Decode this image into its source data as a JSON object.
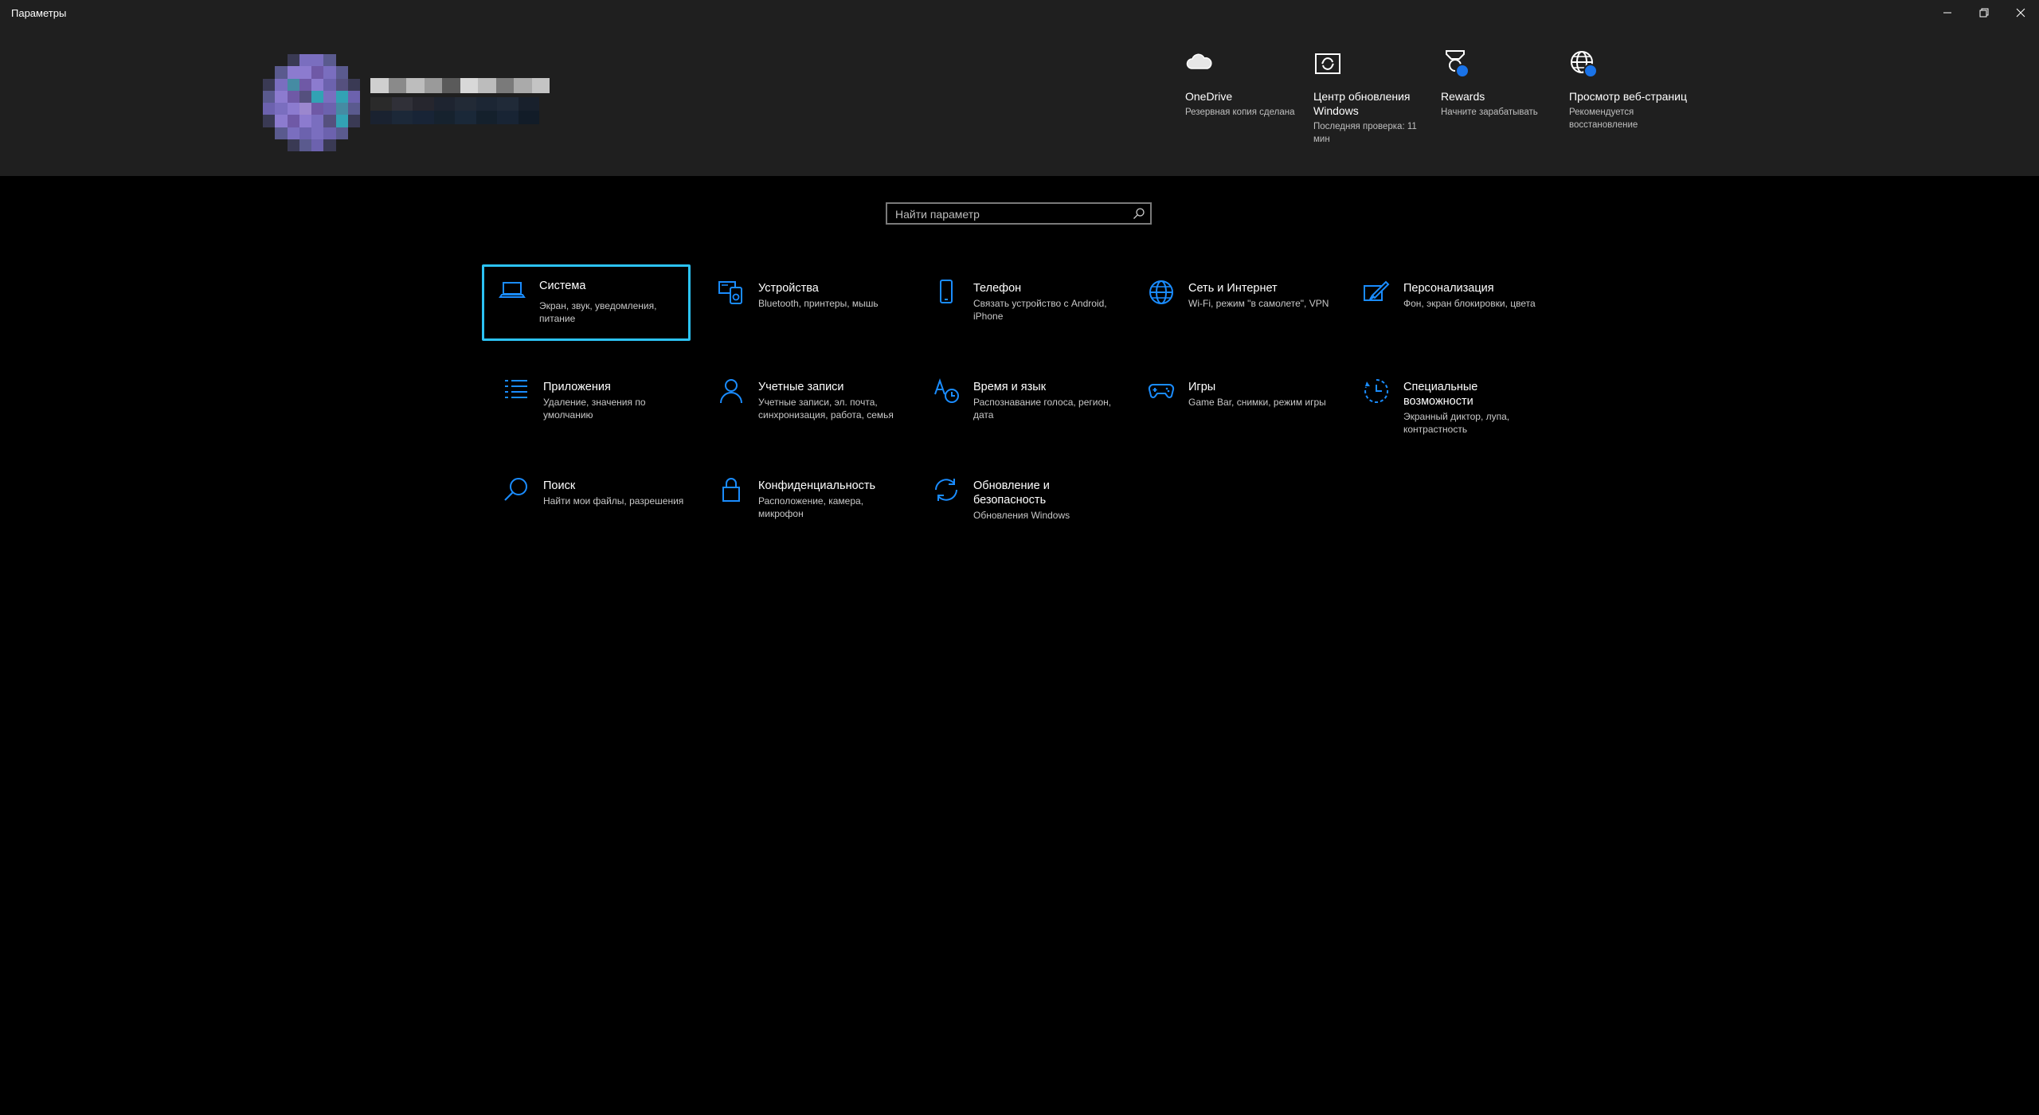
{
  "window": {
    "title": "Параметры",
    "controls": {
      "minimize": "–",
      "maximize": "❐",
      "close": "✕"
    }
  },
  "account": {
    "name_redacted": true
  },
  "quick_links": [
    {
      "title": "OneDrive",
      "subtitle": "Резервная копия сделана",
      "icon": "cloud-icon"
    },
    {
      "title": "Центр обновления Windows",
      "subtitle": "Последняя проверка: 11 мин",
      "icon": "sync-icon"
    },
    {
      "title": "Rewards",
      "subtitle": "Начните зарабатывать",
      "icon": "trophy-icon"
    },
    {
      "title": "Просмотр веб-страниц",
      "subtitle": "Рекомендуется восстановление",
      "icon": "globe-icon"
    }
  ],
  "search": {
    "placeholder": "Найти параметр",
    "value": ""
  },
  "categories": [
    {
      "title": "Система",
      "description": "Экран, звук, уведомления, питание",
      "icon": "laptop-icon"
    },
    {
      "title": "Устройства",
      "description": "Bluetooth, принтеры, мышь",
      "icon": "devices-icon"
    },
    {
      "title": "Телефон",
      "description": "Связать устройство с Android, iPhone",
      "icon": "phone-icon"
    },
    {
      "title": "Сеть и Интернет",
      "description": "Wi-Fi, режим \"в самолете\", VPN",
      "icon": "globe-icon"
    },
    {
      "title": "Персонализация",
      "description": "Фон, экран блокировки, цвета",
      "icon": "brush-icon"
    },
    {
      "title": "Приложения",
      "description": "Удаление, значения по умолчанию",
      "icon": "apps-list-icon"
    },
    {
      "title": "Учетные записи",
      "description": "Учетные записи, эл. почта, синхронизация, работа, семья",
      "icon": "person-icon"
    },
    {
      "title": "Время и язык",
      "description": "Распознавание голоса, регион, дата",
      "icon": "time-language-icon"
    },
    {
      "title": "Игры",
      "description": "Game Bar, снимки, режим игры",
      "icon": "gamepad-icon"
    },
    {
      "title": "Специальные возможности",
      "description": "Экранный диктор, лупа, контрастность",
      "icon": "accessibility-icon"
    },
    {
      "title": "Поиск",
      "description": "Найти мои файлы, разрешения",
      "icon": "search-icon"
    },
    {
      "title": "Конфиденциальность",
      "description": "Расположение, камера, микрофон",
      "icon": "lock-icon"
    },
    {
      "title": "Обновление и безопасность",
      "description": "Обновления Windows",
      "icon": "update-icon"
    }
  ],
  "colors": {
    "accent_blue": "#1a8cff",
    "focus_border": "#2cc3f5",
    "header_bg": "#1f1f1f",
    "page_bg": "#000000"
  }
}
